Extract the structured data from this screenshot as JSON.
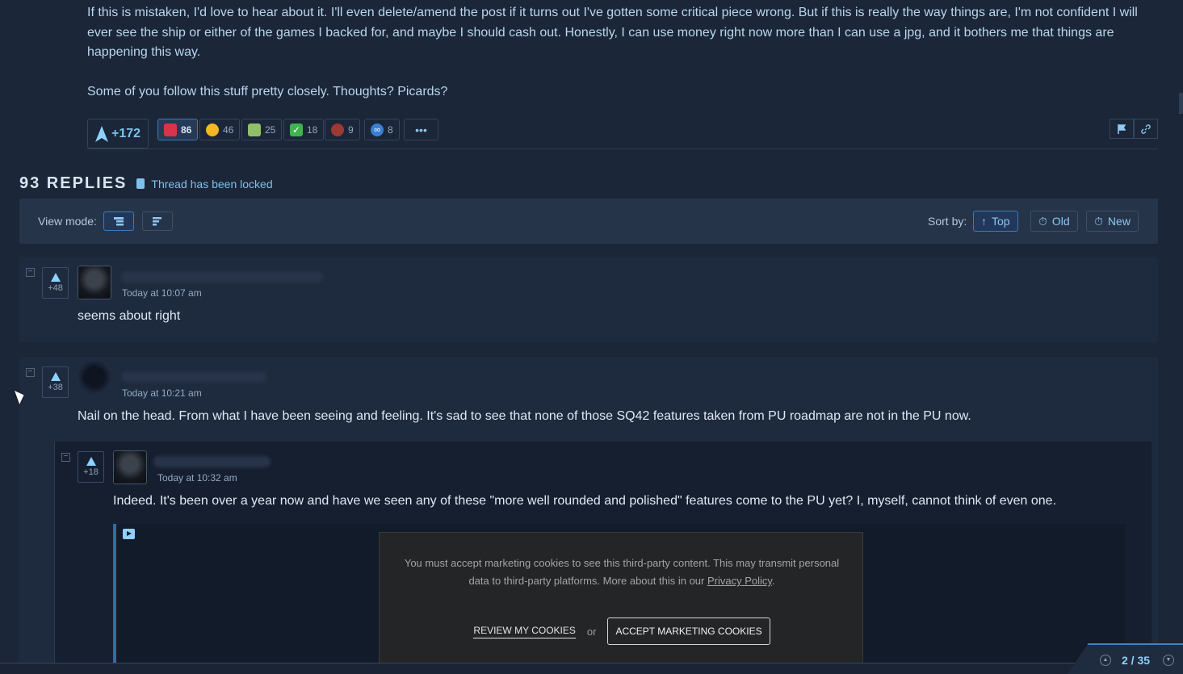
{
  "post": {
    "paragraph1": "If this is mistaken, I'd love to hear about it. I'll even delete/amend the post if it turns out I've gotten some critical piece wrong. But if this is really the way things are, I'm not confident I will ever see the ship or either of the games I backed for, and maybe I should cash out. Honestly, I can use money right now more than I can use a jpg, and it bothers me that things are happening this way.",
    "paragraph2": "Some of you follow this stuff pretty closely. Thoughts? Picards?",
    "vote_score": "+172",
    "reactions": [
      {
        "icon": "hundred-emoji-icon",
        "count": "86",
        "color": "#d8334a"
      },
      {
        "icon": "thumbs-up-icon",
        "count": "46",
        "color": "#f2b820"
      },
      {
        "icon": "money-emoji-icon",
        "count": "25",
        "color": "#8fbf6a"
      },
      {
        "icon": "check-mark-icon",
        "count": "18",
        "color": "#3fb34f"
      },
      {
        "icon": "picard-emoji-icon",
        "count": "9",
        "color": "#9b3a35"
      },
      {
        "icon": "infinity-emoji-icon",
        "count": "8",
        "color": "#3b7fd1"
      }
    ],
    "more_label": "•••"
  },
  "replies": {
    "count_label": "93 REPLIES",
    "locked_label": "Thread has been locked"
  },
  "toolbar": {
    "view_mode_label": "View mode:",
    "sort_label": "Sort by:",
    "sort_top": "Top",
    "sort_old": "Old",
    "sort_new": "New"
  },
  "comments": [
    {
      "score": "+48",
      "time": "Today at 10:07 am",
      "text": "seems about right"
    },
    {
      "score": "+38",
      "time": "Today at 10:21 am",
      "text": "Nail on the head. From what I have been seeing and feeling. It's sad to see that none of those SQ42 features taken from PU roadmap are not in the PU now."
    },
    {
      "score": "+18",
      "time": "Today at 10:32 am",
      "text": "Indeed. It's been over a year now and have we seen any of these \"more well rounded and polished\" features come to the PU yet? I, myself, cannot think of even one."
    }
  ],
  "cookie": {
    "message_1": "You must accept marketing cookies to see this third-party content. This may transmit personal data to third-party platforms. More about this in our ",
    "privacy_link": "Privacy Policy",
    "message_end": ".",
    "review_label": "REVIEW MY COOKIES",
    "or_label": "or",
    "accept_label": "ACCEPT MARKETING COOKIES"
  },
  "pager": {
    "label": "2 / 35"
  },
  "colors": {
    "accent": "#8fd0ff",
    "background": "#1b2638"
  }
}
